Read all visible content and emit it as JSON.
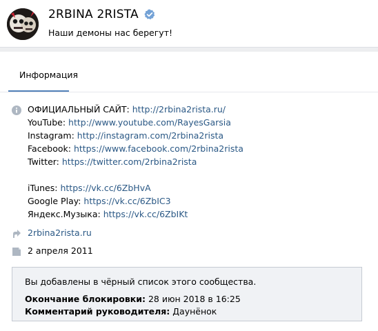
{
  "header": {
    "name": "2RBINA 2RISTA",
    "status": "Наши демоны нас берегут!"
  },
  "tabs": [
    {
      "label": "Информация",
      "active": true
    }
  ],
  "info": {
    "lines": [
      {
        "label": "ОФИЦИАЛЬНЫЙ САЙТ:",
        "value": "http://2rbina2rista.ru/"
      },
      {
        "label": "YouTube:",
        "value": "http://www.youtube.com/RayesGarsia"
      },
      {
        "label": "Instagram:",
        "value": "http://instagram.com/2rbina2rista"
      },
      {
        "label": "Facebook:",
        "value": "https://www.facebook.com/2rbina2rista"
      },
      {
        "label": "Twitter:",
        "value": "https://twitter.com/2rbina2rista"
      },
      {
        "label": "iTunes:",
        "value": "https://vk.cc/6ZbHvA"
      },
      {
        "label": "Google Play:",
        "value": "https://vk.cc/6ZbIC3"
      },
      {
        "label": "Яндекс.Музыка:",
        "value": "https://vk.cc/6ZbIKt"
      }
    ],
    "site_link": "2rbina2rista.ru",
    "created_date": "2 апреля 2011"
  },
  "notice": {
    "message": "Вы добавлены в чёрный список этого сообщества.",
    "block_end_label": "Окончание блокировки:",
    "block_end_value": "28 июн 2018 в 16:25",
    "comment_label": "Комментарий руководителя:",
    "comment_value": "Даунёнок"
  },
  "colors": {
    "link": "#2a5885",
    "accent": "#5181b8",
    "background": "#edeef0",
    "notice_bg": "#f0f2f5"
  },
  "icons": {
    "info": "info-icon",
    "link": "link-arrow-icon",
    "date": "calendar-flag-icon",
    "verified": "verified-check-icon"
  }
}
